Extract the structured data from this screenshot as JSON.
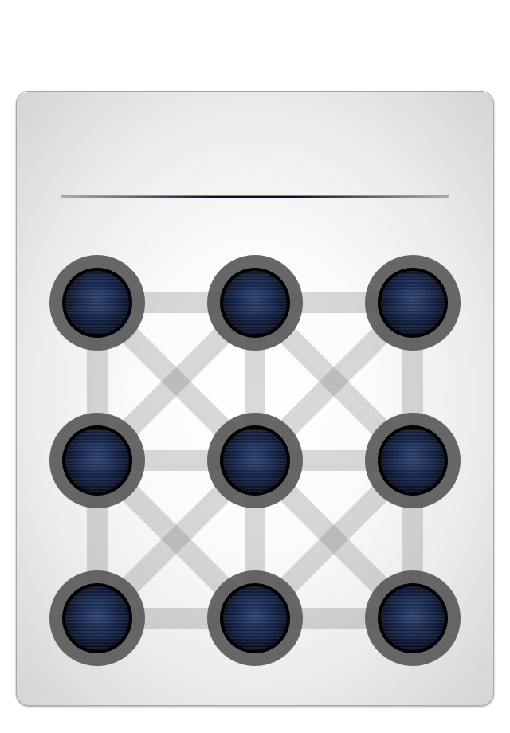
{
  "pattern_lock": {
    "entered_pattern": "",
    "rows": 3,
    "columns": 3,
    "dots": [
      {
        "id": 1
      },
      {
        "id": 2
      },
      {
        "id": 3
      },
      {
        "id": 4
      },
      {
        "id": 5
      },
      {
        "id": 6
      },
      {
        "id": 7
      },
      {
        "id": 8
      },
      {
        "id": 9
      }
    ],
    "colors": {
      "dot_core": "#16254a",
      "dot_ring": "#5a5a5a",
      "connector": "#9a9a9a",
      "indicator_line": "#0c1024"
    }
  }
}
